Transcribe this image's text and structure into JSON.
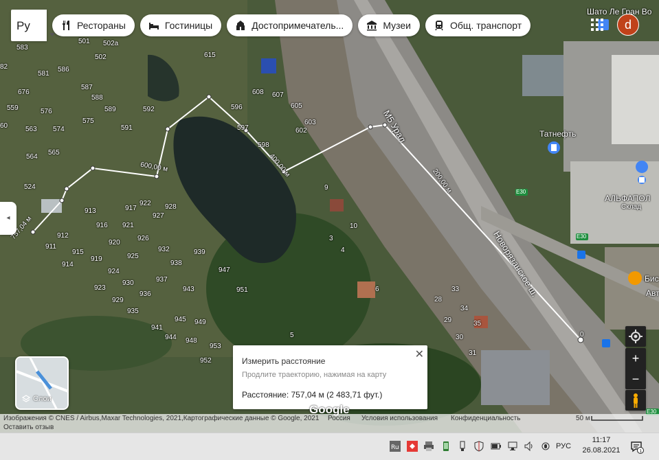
{
  "search": {
    "value": "Ру"
  },
  "chips": [
    {
      "label": "Рестораны",
      "icon": "fork-knife-icon"
    },
    {
      "label": "Гостиницы",
      "icon": "bed-icon"
    },
    {
      "label": "Достопримечатель...",
      "icon": "landmark-icon"
    },
    {
      "label": "Музеи",
      "icon": "museum-icon"
    },
    {
      "label": "Общ. транспорт",
      "icon": "transit-icon"
    }
  ],
  "account": {
    "initial": "d"
  },
  "map_labels": {
    "place_top_right": "Шато Ле Гран Во",
    "road_m5": "М5 Урал",
    "road_novoryazanskoe": "Новорязанское ш.",
    "tatneft": "Татнефть",
    "alfapol": "АЛЬФАПОЛ",
    "sklad": "Склад",
    "bis": "Бис",
    "avt": "Авт",
    "e30": "E30",
    "e30b": "E30",
    "e30c": "E30"
  },
  "house_numbers": [
    {
      "t": "583"
    },
    {
      "t": "501"
    },
    {
      "t": "502а"
    },
    {
      "t": "502"
    },
    {
      "t": "581"
    },
    {
      "t": "586"
    },
    {
      "t": "587"
    },
    {
      "t": "588"
    },
    {
      "t": "676"
    },
    {
      "t": "559"
    },
    {
      "t": "576"
    },
    {
      "t": "575"
    },
    {
      "t": "589"
    },
    {
      "t": "592"
    },
    {
      "t": "591"
    },
    {
      "t": "563"
    },
    {
      "t": "574"
    },
    {
      "t": "565"
    },
    {
      "t": "564"
    },
    {
      "t": "524"
    },
    {
      "t": "615"
    },
    {
      "t": "608"
    },
    {
      "t": "607"
    },
    {
      "t": "596"
    },
    {
      "t": "605"
    },
    {
      "t": "603"
    },
    {
      "t": "597"
    },
    {
      "t": "602"
    },
    {
      "t": "598"
    },
    {
      "t": "9"
    },
    {
      "t": "913"
    },
    {
      "t": "917"
    },
    {
      "t": "922"
    },
    {
      "t": "928"
    },
    {
      "t": "927"
    },
    {
      "t": "916"
    },
    {
      "t": "921"
    },
    {
      "t": "912"
    },
    {
      "t": "926"
    },
    {
      "t": "911"
    },
    {
      "t": "915"
    },
    {
      "t": "920"
    },
    {
      "t": "932"
    },
    {
      "t": "914"
    },
    {
      "t": "919"
    },
    {
      "t": "925"
    },
    {
      "t": "939"
    },
    {
      "t": "938"
    },
    {
      "t": "924"
    },
    {
      "t": "947"
    },
    {
      "t": "930"
    },
    {
      "t": "937"
    },
    {
      "t": "923"
    },
    {
      "t": "943"
    },
    {
      "t": "936"
    },
    {
      "t": "951"
    },
    {
      "t": "929"
    },
    {
      "t": "935"
    },
    {
      "t": "945"
    },
    {
      "t": "949"
    },
    {
      "t": "941"
    },
    {
      "t": "944"
    },
    {
      "t": "948"
    },
    {
      "t": "953"
    },
    {
      "t": "952"
    },
    {
      "t": "10"
    },
    {
      "t": "3"
    },
    {
      "t": "4"
    },
    {
      "t": "6"
    },
    {
      "t": "5"
    },
    {
      "t": "33"
    },
    {
      "t": "28"
    },
    {
      "t": "34"
    },
    {
      "t": "29"
    },
    {
      "t": "35"
    },
    {
      "t": "30"
    },
    {
      "t": "31"
    },
    {
      "t": "60"
    },
    {
      "t": "82"
    }
  ],
  "measure_labels": {
    "m600": "600,00 м",
    "m400": "400,00 м",
    "m200": "200,00 м",
    "m757": "757,04 м",
    "m0": "0"
  },
  "side_toggle": "◂",
  "layers": {
    "label": "Слои"
  },
  "popup": {
    "title": "Измерить расстояние",
    "hint": "Продлите траекторию, нажимая на карту",
    "distance": "Расстояние: 757,04 м (2 483,71 фут.)",
    "close": "✕"
  },
  "zoom": {
    "in": "+",
    "out": "−"
  },
  "google_logo": "Google",
  "footer": {
    "attribution": "Изображения © CNES / Airbus,Maxar Technologies, 2021,Картографические данные © Google, 2021",
    "country": "Россия",
    "terms": "Условия использования",
    "privacy": "Конфиденциальность",
    "scale": "50 м",
    "feedback": "Оставить отзыв"
  },
  "taskbar": {
    "lang": "РУС",
    "time": "11:17",
    "date": "26.08.2021",
    "notif_count": "1",
    "tray_icons": [
      "ru-icon",
      "security-icon",
      "printer-icon",
      "phone-icon",
      "usb-icon",
      "shield-icon",
      "battery-icon",
      "network-icon",
      "volume-icon",
      "lock-icon",
      "mic-icon"
    ]
  }
}
